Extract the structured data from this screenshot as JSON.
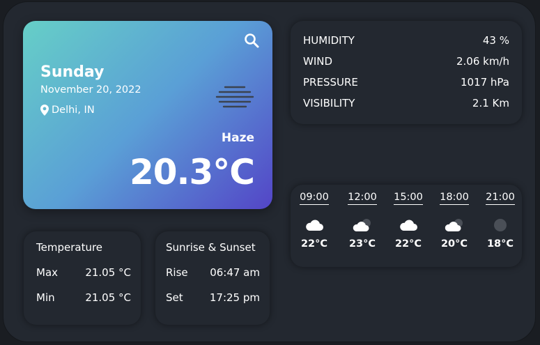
{
  "hero": {
    "day": "Sunday",
    "date": "November 20, 2022",
    "location": "Delhi, IN",
    "condition": "Haze",
    "temperature": "20.3°C"
  },
  "stats": [
    {
      "label": "HUMIDITY",
      "value": "43 %"
    },
    {
      "label": "WIND",
      "value": "2.06 km/h"
    },
    {
      "label": "PRESSURE",
      "value": "1017 hPa"
    },
    {
      "label": "VISIBILITY",
      "value": "2.1 Km"
    }
  ],
  "forecast": [
    {
      "time": "09:00",
      "icon": "cloud-icon",
      "temp": "22°C"
    },
    {
      "time": "12:00",
      "icon": "cloud-moon-icon",
      "temp": "23°C"
    },
    {
      "time": "15:00",
      "icon": "cloud-icon",
      "temp": "22°C"
    },
    {
      "time": "18:00",
      "icon": "cloud-moon-icon",
      "temp": "20°C"
    },
    {
      "time": "21:00",
      "icon": "moon-icon",
      "temp": "18°C"
    }
  ],
  "temperature_panel": {
    "title": "Temperature",
    "max_label": "Max",
    "max_value": "21.05 °C",
    "min_label": "Min",
    "min_value": "21.05 °C"
  },
  "sun_panel": {
    "title": "Sunrise & Sunset",
    "rise_label": "Rise",
    "rise_value": "06:47 am",
    "set_label": "Set",
    "set_value": "17:25 pm"
  },
  "colors": {
    "background": "#232830",
    "gradient_start": "#66cfc7",
    "gradient_end": "#5345c7"
  }
}
